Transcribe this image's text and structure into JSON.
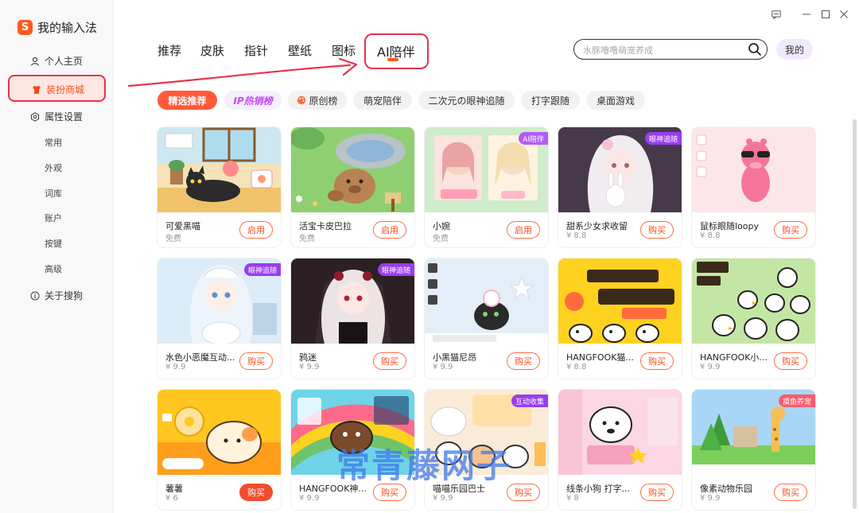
{
  "app": {
    "title": "我的输入法",
    "logo_glyph": "S"
  },
  "sidebar": {
    "items": [
      {
        "label": "个人主页",
        "icon": "person-icon"
      },
      {
        "label": "装扮商城",
        "icon": "shirt-icon",
        "active": true
      },
      {
        "label": "属性设置",
        "icon": "gear-icon"
      },
      {
        "label": "关于搜狗",
        "icon": "info-icon"
      }
    ],
    "sub_items": [
      "常用",
      "外观",
      "词库",
      "账户",
      "按键",
      "高级"
    ]
  },
  "tabs": [
    "推荐",
    "皮肤",
    "指针",
    "壁纸",
    "图标",
    "AI陪伴"
  ],
  "search": {
    "placeholder": "水豚噜噜萌宠养成"
  },
  "mine_label": "我的",
  "chips": [
    "精选推荐",
    "IP热销榜",
    "原创榜",
    "萌宠陪伴",
    "二次元の眼神追随",
    "打字跟随",
    "桌面游戏"
  ],
  "cards": [
    {
      "name": "可爱黑喵",
      "price": "免费",
      "button": "启用",
      "badge": ""
    },
    {
      "name": "活宝卡皮巴拉",
      "price": "免费",
      "button": "启用",
      "badge": ""
    },
    {
      "name": "小婉",
      "price": "免费",
      "button": "启用",
      "badge": "AI陪伴"
    },
    {
      "name": "甜系少女求收留",
      "price": "¥ 8.8",
      "button": "购买",
      "badge": "眼神追随"
    },
    {
      "name": "鼠标眼随loopy",
      "price": "¥ 8.8",
      "button": "购买",
      "badge": ""
    },
    {
      "name": "水色小恶魔互动...",
      "price": "¥ 9.9",
      "button": "购买",
      "badge": "眼神追随"
    },
    {
      "name": "鸦迷",
      "price": "¥ 9.9",
      "button": "购买",
      "badge": "眼神追随"
    },
    {
      "name": "小黑猫尼昂",
      "price": "¥ 9.9",
      "button": "购买",
      "badge": ""
    },
    {
      "name": "HANGFOOK猫...",
      "price": "¥ 8.8",
      "button": "购买",
      "badge": ""
    },
    {
      "name": "HANGFOOK小...",
      "price": "¥ 9.9",
      "button": "购买",
      "badge": ""
    },
    {
      "name": "薯薯",
      "price": "¥ 6",
      "button": "购买",
      "badge": ""
    },
    {
      "name": "HANGFOOK神...",
      "price": "¥ 9.9",
      "button": "购买",
      "badge": ""
    },
    {
      "name": "喵喵乐园巴士",
      "price": "¥ 9.9",
      "button": "购买",
      "badge": "互动收集"
    },
    {
      "name": "线条小狗 打字...",
      "price": "¥ 8",
      "button": "购买",
      "badge": ""
    },
    {
      "name": "像素动物乐园",
      "price": "¥ 9.9",
      "button": "购买",
      "badge": "摸鱼养宠"
    }
  ],
  "watermark": "常青藤网子",
  "colors": {
    "accent": "#ff5a22",
    "highlight_box": "#e8334a",
    "badge_purple": "#9a3cf0",
    "watermark": "#3e78eb"
  }
}
